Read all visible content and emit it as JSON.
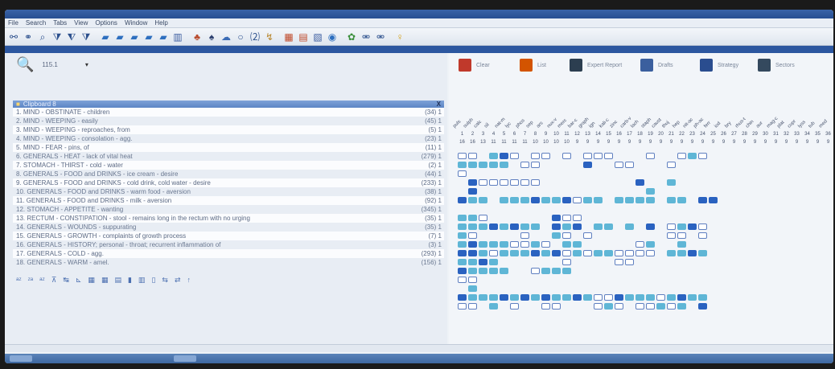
{
  "window": {
    "title": "",
    "menu": [
      "File",
      "Search",
      "Tabs",
      "View",
      "Options",
      "Window",
      "Help"
    ]
  },
  "toolbar": {
    "icons": [
      "binoculars-icon",
      "binoculars2-icon",
      "magnifier-icon",
      "filter-icon",
      "filter2-icon",
      "filter3-icon",
      "book1-icon",
      "book2-icon",
      "book3-icon",
      "book4-icon",
      "book5-icon",
      "books-icon",
      "tree-icon",
      "flask-icon",
      "cloud-icon",
      "ring-icon",
      "num-icon",
      "arrow-icon",
      "doc1-icon",
      "doc2-icon",
      "doc3-icon",
      "globe-icon",
      "plant-icon",
      "handshake-icon",
      "handshake2-icon",
      "bulb-icon"
    ]
  },
  "subwindow": {
    "title": ""
  },
  "search": {
    "icon": "search-key-icon",
    "value": "115.1",
    "dropdown": ""
  },
  "clipboard": {
    "title": "Clipboard 8",
    "close": "X"
  },
  "rubrics": [
    {
      "label": "1. MIND - OBSTINATE - children",
      "count": "(34) 1"
    },
    {
      "label": "2. MIND - WEEPING - easily",
      "count": "(45) 1"
    },
    {
      "label": "3. MIND - WEEPING - reproaches, from",
      "count": "(5) 1"
    },
    {
      "label": "4. MIND - WEEPING - consolation - agg.",
      "count": "(23) 1"
    },
    {
      "label": "5. MIND - FEAR - pins, of",
      "count": "(11) 1"
    },
    {
      "label": "6. GENERALS - HEAT - lack of vital heat",
      "count": "(279) 1"
    },
    {
      "label": "7. STOMACH - THIRST - cold - water",
      "count": "(2) 1"
    },
    {
      "label": "8. GENERALS - FOOD and DRINKS - ice cream - desire",
      "count": "(44) 1"
    },
    {
      "label": "9. GENERALS - FOOD and DRINKS - cold drink, cold water - desire",
      "count": "(233) 1"
    },
    {
      "label": "10. GENERALS - FOOD and DRINKS - warm food - aversion",
      "count": "(38) 1"
    },
    {
      "label": "11. GENERALS - FOOD and DRINKS - milk - aversion",
      "count": "(92) 1"
    },
    {
      "label": "12. STOMACH - APPETITE - wanting",
      "count": "(345) 1"
    },
    {
      "label": "13. RECTUM - CONSTIPATION - stool - remains long in the rectum with no urging",
      "count": "(35) 1"
    },
    {
      "label": "14. GENERALS - WOUNDS - suppurating",
      "count": "(35) 1"
    },
    {
      "label": "15. GENERALS - GROWTH - complaints of growth process",
      "count": "(7) 1"
    },
    {
      "label": "16. GENERALS - HISTORY; personal - throat; recurrent inflammation of",
      "count": "(3) 1"
    },
    {
      "label": "17. GENERALS - COLD - agg.",
      "count": "(293) 1"
    },
    {
      "label": "18. GENERALS - WARM - amel.",
      "count": "(156) 1"
    }
  ],
  "remedies_toolbar": [
    {
      "label": "Clear",
      "icon": "person-icon",
      "color": "#c0392b"
    },
    {
      "label": "List",
      "icon": "face-icon",
      "color": "#d35400"
    },
    {
      "label": "Expert Report",
      "icon": "book-icon",
      "color": "#2c3e50"
    },
    {
      "label": "Drafts",
      "icon": "chart-icon",
      "color": "#3b5f9e"
    },
    {
      "label": "Strategy",
      "icon": "gears-icon",
      "color": "#2a4d8f"
    },
    {
      "label": "Sectors",
      "icon": "building-icon",
      "color": "#34495e"
    }
  ],
  "grid": {
    "column_numbers": [
      "1",
      "2",
      "3",
      "4",
      "5",
      "6",
      "7",
      "8",
      "9",
      "10",
      "11",
      "12",
      "13",
      "14",
      "15",
      "16",
      "17",
      "18",
      "19",
      "20",
      "21",
      "22",
      "23",
      "24",
      "25",
      "26",
      "27",
      "28",
      "29",
      "30",
      "31",
      "32",
      "33",
      "34",
      "35",
      "36"
    ],
    "scores": [
      "16",
      "16",
      "13",
      "11",
      "11",
      "11",
      "11",
      "10",
      "10",
      "10",
      "10",
      "9",
      "9",
      "9",
      "9",
      "9",
      "9",
      "9",
      "9",
      "9",
      "9",
      "9",
      "9",
      "9",
      "9",
      "9",
      "9",
      "9",
      "9",
      "9",
      "9",
      "9",
      "9",
      "9",
      "9",
      "9"
    ],
    "abbr": [
      "puls",
      "sulph",
      "calc",
      "sil",
      "nat-m",
      "lyc",
      "phos",
      "sep",
      "ars",
      "nux-v",
      "merc",
      "bar-c",
      "graph",
      "ign",
      "kali-c",
      "zinc",
      "carb-v",
      "lach",
      "staph",
      "caust",
      "thuj",
      "hep",
      "nit-ac",
      "ph-ac",
      "ferr",
      "iod",
      "bry",
      "rhus-t",
      "chin",
      "aur",
      "mag-c",
      "plat",
      "cupr",
      "lyss",
      "tub",
      "med"
    ],
    "rows": [
      [
        1,
        1,
        0,
        2,
        3,
        1,
        0,
        1,
        1,
        0,
        1,
        0,
        1,
        1,
        1,
        0,
        0,
        0,
        1,
        0,
        0,
        1,
        2,
        1,
        0,
        0,
        0,
        0,
        0,
        0,
        0,
        0,
        0,
        0,
        0,
        0
      ],
      [
        2,
        2,
        2,
        2,
        2,
        0,
        1,
        1,
        0,
        0,
        0,
        0,
        3,
        0,
        0,
        1,
        1,
        0,
        0,
        0,
        1,
        0,
        0,
        0,
        0,
        0,
        0,
        0,
        0,
        0,
        0,
        0,
        0,
        0,
        0,
        0
      ],
      [
        1,
        0,
        0,
        0,
        0,
        0,
        0,
        0,
        0,
        0,
        0,
        0,
        0,
        0,
        0,
        0,
        0,
        0,
        0,
        0,
        0,
        0,
        0,
        0,
        0,
        0,
        0,
        0,
        0,
        0,
        0,
        0,
        0,
        0,
        0,
        0
      ],
      [
        0,
        3,
        1,
        1,
        1,
        1,
        1,
        1,
        0,
        0,
        0,
        0,
        0,
        0,
        0,
        0,
        0,
        3,
        0,
        0,
        2,
        0,
        0,
        0,
        0,
        0,
        0,
        0,
        0,
        0,
        0,
        0,
        0,
        0,
        0,
        0
      ],
      [
        0,
        3,
        0,
        0,
        0,
        0,
        0,
        0,
        0,
        0,
        0,
        0,
        0,
        0,
        0,
        0,
        0,
        0,
        2,
        0,
        0,
        0,
        0,
        0,
        0,
        0,
        0,
        0,
        0,
        0,
        0,
        0,
        0,
        0,
        0,
        0
      ],
      [
        3,
        2,
        2,
        0,
        2,
        2,
        2,
        3,
        2,
        2,
        3,
        1,
        2,
        2,
        0,
        2,
        2,
        2,
        2,
        0,
        2,
        2,
        0,
        3,
        3,
        0,
        0,
        0,
        0,
        0,
        0,
        0,
        0,
        0,
        0,
        0
      ],
      [
        0,
        0,
        0,
        0,
        0,
        0,
        0,
        0,
        0,
        0,
        0,
        0,
        0,
        0,
        0,
        0,
        0,
        0,
        0,
        0,
        0,
        0,
        0,
        0,
        0,
        0,
        0,
        0,
        0,
        0,
        0,
        0,
        0,
        0,
        0,
        0
      ],
      [
        2,
        2,
        1,
        0,
        0,
        0,
        0,
        0,
        0,
        3,
        1,
        1,
        0,
        0,
        0,
        0,
        0,
        0,
        0,
        0,
        0,
        0,
        0,
        0,
        0,
        0,
        0,
        0,
        0,
        0,
        0,
        0,
        0,
        0,
        0,
        0
      ],
      [
        2,
        2,
        2,
        3,
        2,
        3,
        2,
        2,
        0,
        3,
        2,
        3,
        0,
        2,
        2,
        0,
        2,
        0,
        3,
        0,
        1,
        2,
        3,
        1,
        0,
        0,
        0,
        0,
        0,
        0,
        0,
        0,
        0,
        0,
        0,
        0
      ],
      [
        2,
        1,
        0,
        0,
        0,
        0,
        1,
        0,
        0,
        2,
        1,
        0,
        1,
        0,
        0,
        0,
        0,
        0,
        0,
        0,
        1,
        1,
        0,
        1,
        0,
        0,
        0,
        0,
        0,
        0,
        0,
        0,
        0,
        0,
        0,
        0
      ],
      [
        2,
        3,
        2,
        2,
        2,
        1,
        1,
        2,
        1,
        0,
        2,
        2,
        0,
        0,
        0,
        0,
        0,
        1,
        2,
        0,
        0,
        2,
        0,
        0,
        0,
        0,
        0,
        0,
        0,
        0,
        0,
        0,
        0,
        0,
        0,
        0
      ],
      [
        3,
        3,
        2,
        1,
        2,
        2,
        2,
        3,
        2,
        3,
        1,
        2,
        1,
        2,
        2,
        1,
        1,
        1,
        1,
        0,
        2,
        2,
        3,
        2,
        0,
        0,
        0,
        0,
        0,
        0,
        0,
        0,
        0,
        0,
        0,
        0
      ],
      [
        2,
        2,
        3,
        2,
        0,
        0,
        0,
        0,
        0,
        0,
        1,
        0,
        0,
        0,
        0,
        1,
        1,
        0,
        0,
        0,
        0,
        0,
        0,
        0,
        0,
        0,
        0,
        0,
        0,
        0,
        0,
        0,
        0,
        0,
        0,
        0
      ],
      [
        3,
        2,
        2,
        2,
        2,
        0,
        0,
        1,
        2,
        2,
        2,
        0,
        0,
        0,
        0,
        0,
        0,
        0,
        0,
        0,
        0,
        0,
        0,
        0,
        0,
        0,
        0,
        0,
        0,
        0,
        0,
        0,
        0,
        0,
        0,
        0
      ],
      [
        1,
        1,
        0,
        0,
        0,
        0,
        0,
        0,
        0,
        0,
        0,
        0,
        0,
        0,
        0,
        0,
        0,
        0,
        0,
        0,
        0,
        0,
        0,
        0,
        0,
        0,
        0,
        0,
        0,
        0,
        0,
        0,
        0,
        0,
        0,
        0
      ],
      [
        0,
        2,
        0,
        0,
        0,
        0,
        0,
        0,
        0,
        0,
        0,
        0,
        0,
        0,
        0,
        0,
        0,
        0,
        0,
        0,
        0,
        0,
        0,
        0,
        0,
        0,
        0,
        0,
        0,
        0,
        0,
        0,
        0,
        0,
        0,
        0
      ],
      [
        3,
        2,
        2,
        2,
        3,
        2,
        3,
        2,
        3,
        2,
        2,
        3,
        2,
        1,
        1,
        3,
        2,
        2,
        2,
        1,
        2,
        3,
        2,
        2,
        0,
        0,
        0,
        0,
        0,
        0,
        0,
        0,
        0,
        0,
        0,
        0
      ],
      [
        1,
        1,
        0,
        2,
        0,
        1,
        0,
        0,
        1,
        1,
        0,
        0,
        0,
        1,
        2,
        1,
        0,
        1,
        1,
        2,
        1,
        2,
        0,
        3,
        0,
        0,
        0,
        0,
        0,
        0,
        0,
        0,
        0,
        0,
        0,
        0
      ]
    ]
  },
  "bottom_toolbar": {
    "icons": [
      "sort-az-icon",
      "sort-za-icon",
      "sort-icon",
      "filter-bottom-icon",
      "swap-icon",
      "chart-bottom-icon",
      "grid-icon",
      "grid2-icon",
      "table-icon",
      "marker-icon",
      "copy-icon",
      "paste-icon",
      "compare-icon",
      "flip-icon",
      "pin-icon"
    ]
  },
  "status": {
    "left": "",
    "mid": "",
    "right1": "",
    "right2": ""
  }
}
